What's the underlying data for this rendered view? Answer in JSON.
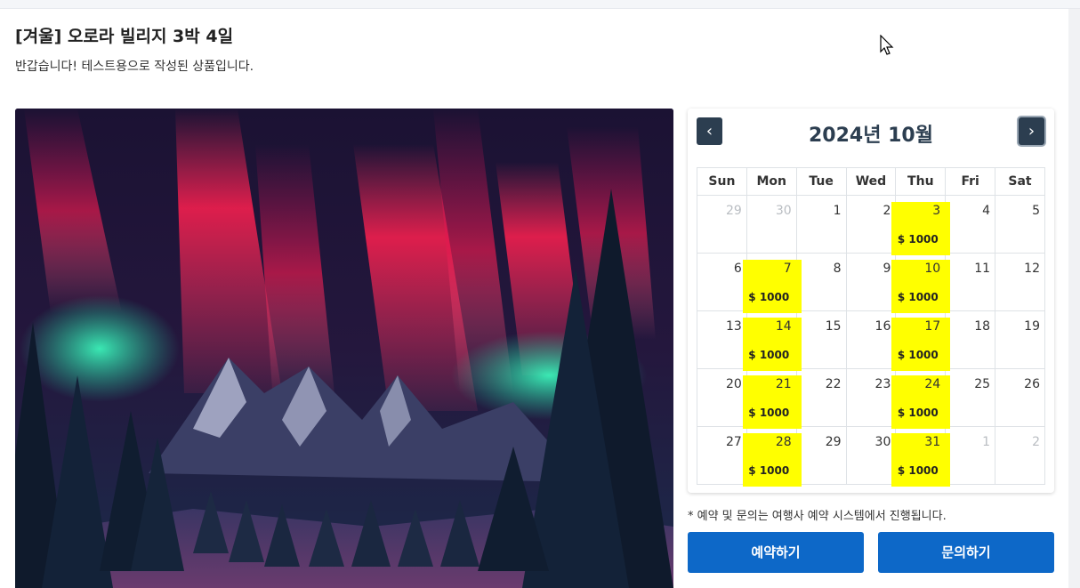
{
  "product": {
    "title": "[겨울] 오로라 빌리지 3박 4일",
    "description": "반갑습니다! 테스트용으로 작성된 상품입니다."
  },
  "calendar": {
    "month_label": "2024년 10월",
    "prev_icon": "chevron-left-icon",
    "next_icon": "chevron-right-icon",
    "weekdays": [
      "Sun",
      "Mon",
      "Tue",
      "Wed",
      "Thu",
      "Fri",
      "Sat"
    ],
    "highlight_color": "#ffff00",
    "weeks": [
      [
        {
          "day": "29",
          "muted": true
        },
        {
          "day": "30",
          "muted": true
        },
        {
          "day": "1"
        },
        {
          "day": "2"
        },
        {
          "day": "3",
          "price": "$ 1000"
        },
        {
          "day": "4"
        },
        {
          "day": "5"
        }
      ],
      [
        {
          "day": "6"
        },
        {
          "day": "7",
          "price": "$ 1000"
        },
        {
          "day": "8"
        },
        {
          "day": "9"
        },
        {
          "day": "10",
          "price": "$ 1000"
        },
        {
          "day": "11"
        },
        {
          "day": "12"
        }
      ],
      [
        {
          "day": "13"
        },
        {
          "day": "14",
          "price": "$ 1000"
        },
        {
          "day": "15"
        },
        {
          "day": "16"
        },
        {
          "day": "17",
          "price": "$ 1000"
        },
        {
          "day": "18"
        },
        {
          "day": "19"
        }
      ],
      [
        {
          "day": "20"
        },
        {
          "day": "21",
          "price": "$ 1000"
        },
        {
          "day": "22"
        },
        {
          "day": "23"
        },
        {
          "day": "24",
          "price": "$ 1000"
        },
        {
          "day": "25"
        },
        {
          "day": "26"
        }
      ],
      [
        {
          "day": "27"
        },
        {
          "day": "28",
          "price": "$ 1000"
        },
        {
          "day": "29"
        },
        {
          "day": "30"
        },
        {
          "day": "31",
          "price": "$ 1000"
        },
        {
          "day": "1",
          "muted": true
        },
        {
          "day": "2",
          "muted": true
        }
      ]
    ]
  },
  "notice": "* 예약 및 문의는 여행사 예약 시스템에서 진행됩니다.",
  "buttons": {
    "reserve_label": "예약하기",
    "inquire_label": "문의하기",
    "color": "#0d68c8"
  }
}
